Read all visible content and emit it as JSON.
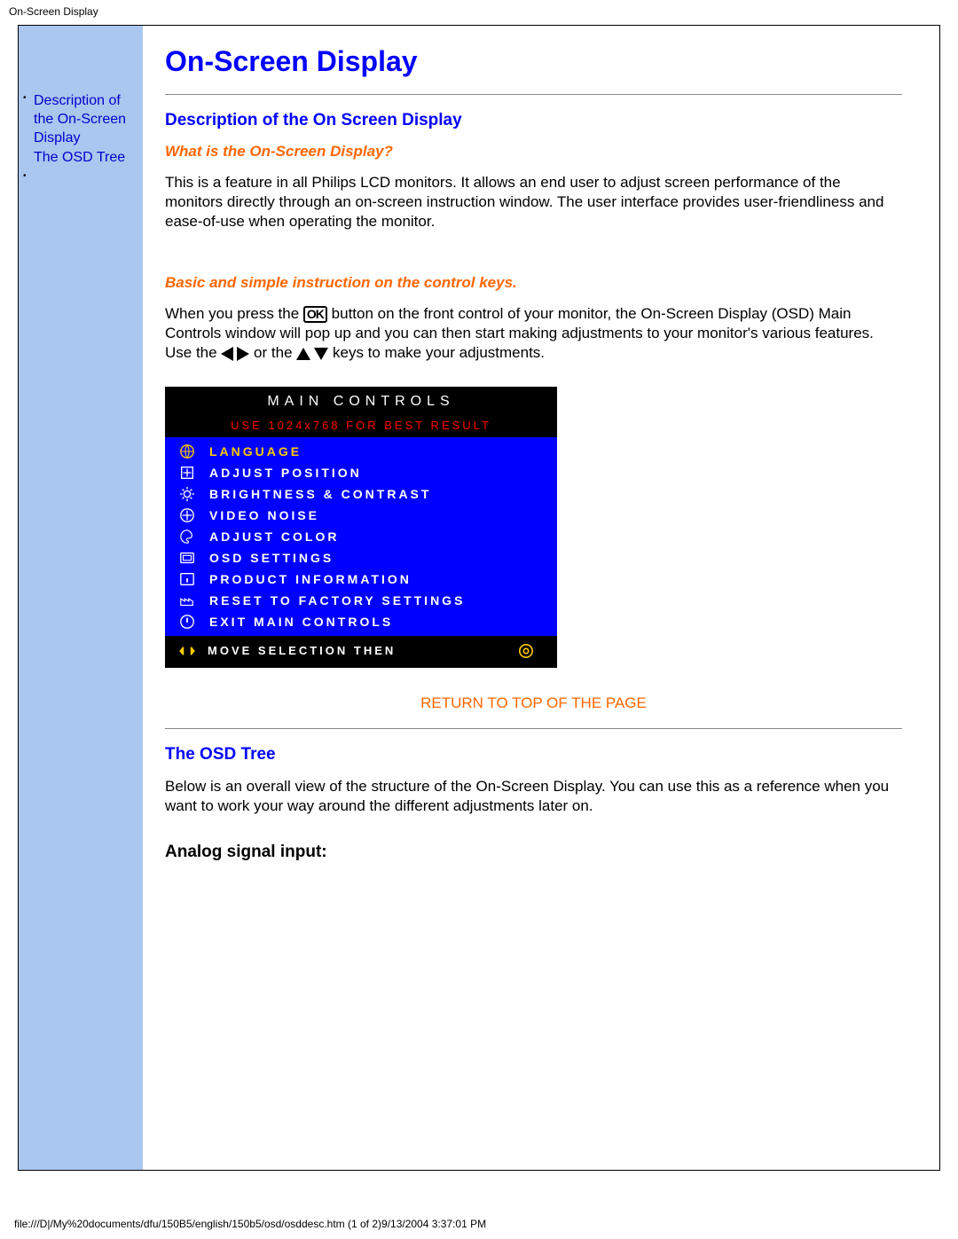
{
  "header": {
    "doc_title": "On-Screen Display"
  },
  "sidebar": {
    "items": [
      {
        "label": "Description of the On-Screen Display"
      },
      {
        "label": "The OSD Tree"
      }
    ]
  },
  "main": {
    "title": "On-Screen Display",
    "section1_heading": "Description of the On Screen Display",
    "sub1": "What is the On-Screen Display?",
    "para1": "This is a feature in all Philips LCD monitors. It allows an end user to adjust screen performance of the monitors directly through an on-screen instruction window. The user interface provides user-friendliness and ease-of-use when operating the monitor.",
    "sub2": "Basic and simple instruction on the control keys.",
    "para2_a": "When you press the ",
    "para2_ok": "OK",
    "para2_b": " button on the front control of your monitor, the On-Screen Display (OSD) Main Controls window will pop up and you can then start making adjustments to your monitor's various features. Use the ",
    "para2_or": " or the ",
    "para2_c": " keys to make your adjustments.",
    "return_link": "RETURN TO TOP OF THE PAGE",
    "section2_heading": "The OSD Tree",
    "para3": "Below is an overall view of the structure of the On-Screen Display. You can use this as a reference when you want to work your way around the different adjustments later on.",
    "analog_heading": "Analog signal input:"
  },
  "osd": {
    "title": "MAIN CONTROLS",
    "hint": "USE 1024x768 FOR BEST RESULT",
    "items": [
      {
        "label": "LANGUAGE",
        "icon": "globe",
        "selected": true
      },
      {
        "label": "ADJUST POSITION",
        "icon": "position",
        "selected": false
      },
      {
        "label": "BRIGHTNESS & CONTRAST",
        "icon": "sun",
        "selected": false
      },
      {
        "label": "VIDEO NOISE",
        "icon": "cross-circle",
        "selected": false
      },
      {
        "label": "ADJUST COLOR",
        "icon": "palette",
        "selected": false
      },
      {
        "label": "OSD SETTINGS",
        "icon": "screen",
        "selected": false
      },
      {
        "label": "PRODUCT INFORMATION",
        "icon": "info",
        "selected": false
      },
      {
        "label": "RESET TO FACTORY SETTINGS",
        "icon": "factory",
        "selected": false
      },
      {
        "label": "EXIT MAIN CONTROLS",
        "icon": "exit",
        "selected": false
      }
    ],
    "footer_text": "MOVE SELECTION THEN"
  },
  "footer": {
    "path": "file:///D|/My%20documents/dfu/150B5/english/150b5/osd/osddesc.htm (1 of 2)9/13/2004 3:37:01 PM"
  }
}
